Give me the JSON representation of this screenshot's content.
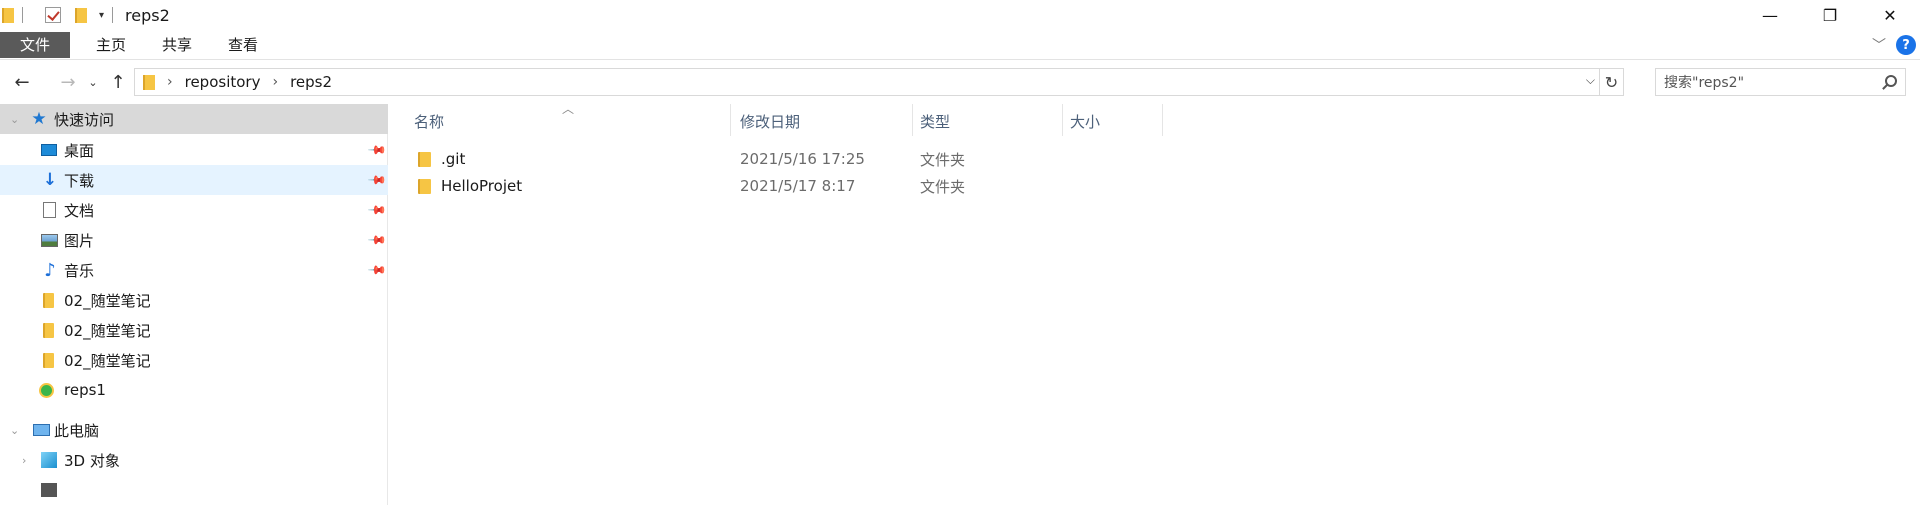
{
  "window": {
    "title": "reps2",
    "controls": {
      "minimize": "—",
      "maximize": "❐",
      "close": "✕"
    }
  },
  "ribbon": {
    "tabs": [
      {
        "label": "文件"
      },
      {
        "label": "主页"
      },
      {
        "label": "共享"
      },
      {
        "label": "查看"
      }
    ],
    "help": "?"
  },
  "address": {
    "crumbs": [
      "repository",
      "reps2"
    ],
    "search_placeholder": "搜索\"reps2\""
  },
  "navigation": {
    "quick_access": "快速访问",
    "pinned": [
      {
        "label": "桌面",
        "icon": "desktop-icon"
      },
      {
        "label": "下载",
        "icon": "download-icon"
      },
      {
        "label": "文档",
        "icon": "document-icon"
      },
      {
        "label": "图片",
        "icon": "pictures-icon"
      },
      {
        "label": "音乐",
        "icon": "music-icon"
      }
    ],
    "folders": [
      {
        "label": "02_随堂笔记"
      },
      {
        "label": "02_随堂笔记"
      },
      {
        "label": "02_随堂笔记"
      },
      {
        "label": "reps1"
      }
    ],
    "this_pc": "此电脑",
    "objects_3d": "3D 对象"
  },
  "content": {
    "columns": {
      "name": "名称",
      "date": "修改日期",
      "type": "类型",
      "size": "大小"
    },
    "files": [
      {
        "name": ".git",
        "date": "2021/5/16 17:25",
        "type": "文件夹"
      },
      {
        "name": "HelloProjet",
        "date": "2021/5/17 8:17",
        "type": "文件夹"
      }
    ]
  },
  "colors": {
    "file_tab_bg": "#5a5a5a",
    "selected_nav": "#d9d9d9",
    "hover_nav": "#e5f3ff",
    "folder": "#f6c544",
    "accent": "#1a73e8",
    "column_header": "#4c607a"
  }
}
